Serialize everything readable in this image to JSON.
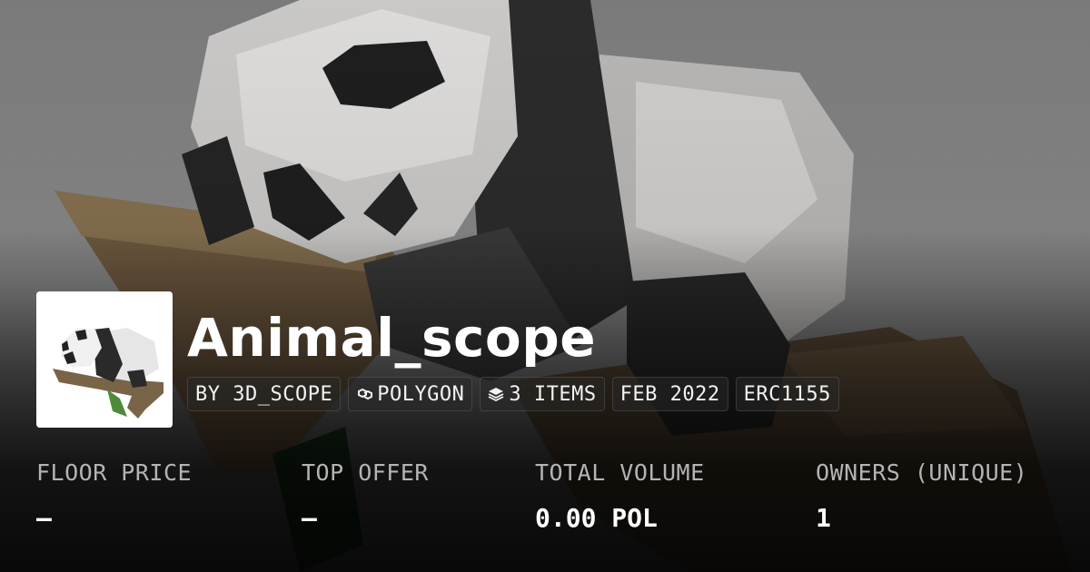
{
  "collection": {
    "name": "Animal_scope",
    "tags": {
      "creator": "BY 3D_SCOPE",
      "chain": "POLYGON",
      "items": "3 ITEMS",
      "date": "FEB 2022",
      "standard": "ERC1155"
    },
    "thumbnail_icon": "panda-thumbnail"
  },
  "stats": {
    "floor": {
      "label": "FLOOR PRICE",
      "value": "–"
    },
    "offer": {
      "label": "TOP OFFER",
      "value": "–"
    },
    "volume": {
      "label": "TOTAL VOLUME",
      "value": "0.00 POL"
    },
    "owners": {
      "label": "OWNERS (UNIQUE)",
      "value": "1"
    }
  },
  "colors": {
    "text": "#ffffff",
    "label": "#b4b4b4",
    "panda_black": "#2a2a2a",
    "branch": "#7a6448"
  }
}
